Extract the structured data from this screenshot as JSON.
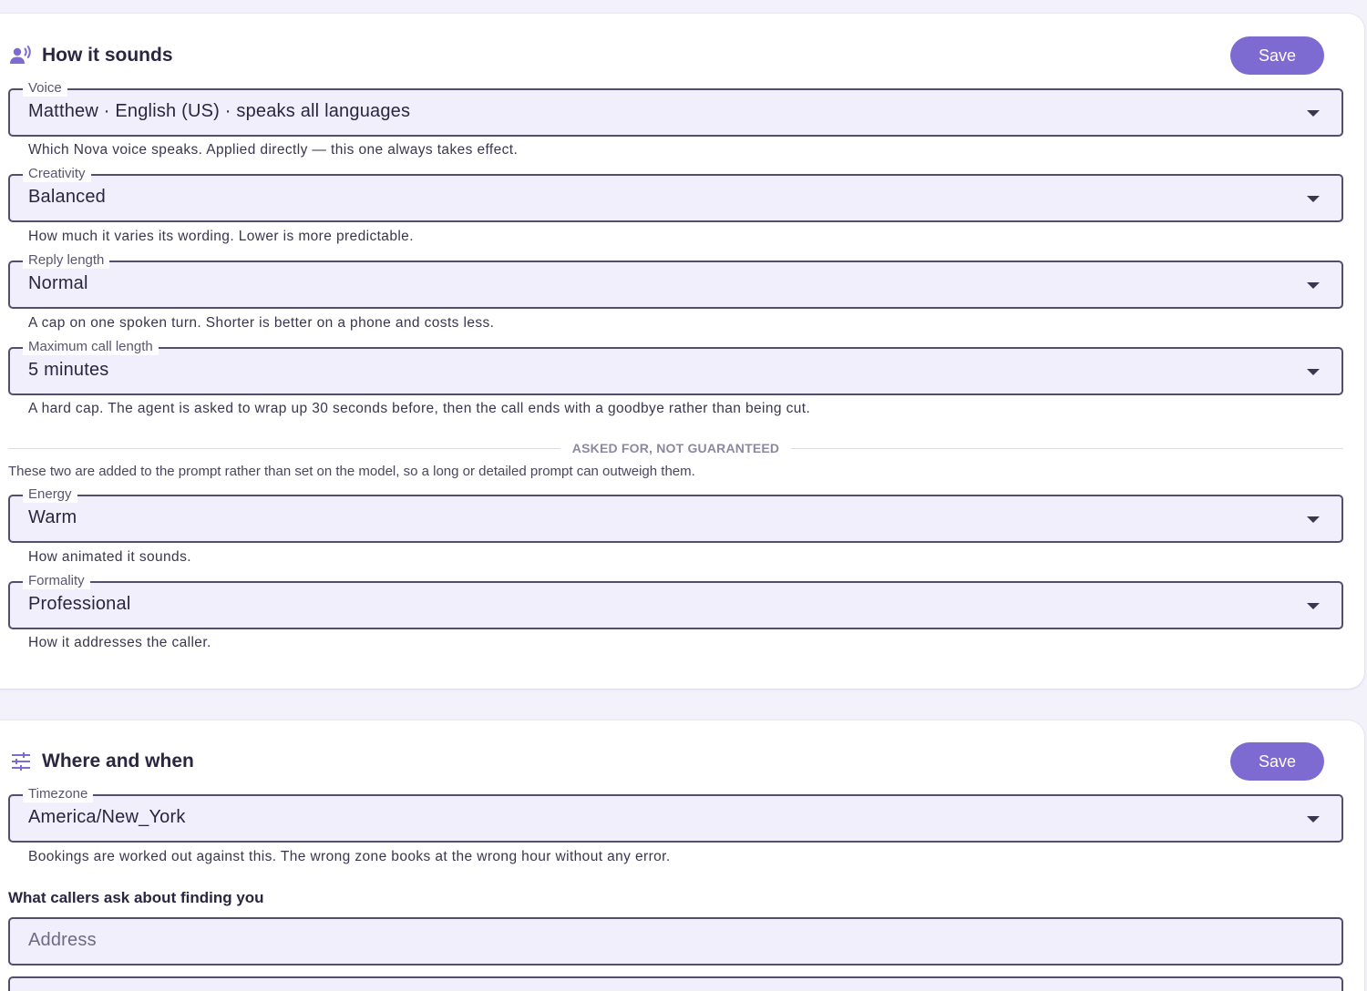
{
  "sound_card": {
    "title": "How it sounds",
    "icon": "voice-person-icon",
    "save_label": "Save",
    "fields": {
      "voice": {
        "label": "Voice",
        "value": "Matthew · English (US) · speaks all languages",
        "helper": "Which Nova voice speaks. Applied directly — this one always takes effect."
      },
      "creativity": {
        "label": "Creativity",
        "value": "Balanced",
        "helper": "How much it varies its wording. Lower is more predictable."
      },
      "reply_length": {
        "label": "Reply length",
        "value": "Normal",
        "helper": "A cap on one spoken turn. Shorter is better on a phone and costs less."
      },
      "max_call_length": {
        "label": "Maximum call length",
        "value": "5 minutes",
        "helper": "A hard cap. The agent is asked to wrap up 30 seconds before, then the call ends with a goodbye rather than being cut."
      },
      "energy": {
        "label": "Energy",
        "value": "Warm",
        "helper": "How animated it sounds."
      },
      "formality": {
        "label": "Formality",
        "value": "Professional",
        "helper": "How it addresses the caller."
      }
    },
    "divider_label": "ASKED FOR, NOT GUARANTEED",
    "divider_note": "These two are added to the prompt rather than set on the model, so a long or detailed prompt can outweigh them."
  },
  "where_card": {
    "title": "Where and when",
    "icon": "tune-sliders-icon",
    "save_label": "Save",
    "timezone": {
      "label": "Timezone",
      "value": "America/New_York",
      "helper": "Bookings are worked out against this. The wrong zone books at the wrong hour without any error."
    },
    "finding_label": "What callers ask about finding you",
    "address_placeholder": "Address"
  },
  "colors": {
    "accent": "#7e6bd1",
    "field_bg": "#f1effb",
    "field_border": "#544d6e"
  }
}
